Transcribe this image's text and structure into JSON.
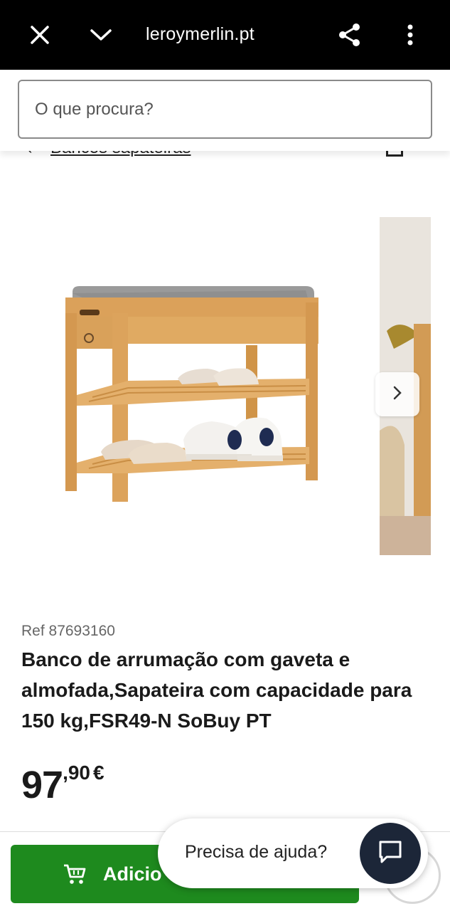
{
  "browser": {
    "url": "leroymerlin.pt",
    "close_icon": "close-icon",
    "collapse_icon": "chevron-down-icon",
    "share_icon": "share-icon",
    "menu_icon": "more-vertical-icon"
  },
  "search": {
    "placeholder": "O que procura?"
  },
  "breadcrumb": {
    "label": "Bancos sapateiras"
  },
  "gallery": {
    "next_icon": "chevron-right-icon"
  },
  "product": {
    "ref": "Ref 87693160",
    "title": "Banco de arrumação com gaveta e almofada,Sapateira com capacidade para 150 kg,FSR49-N SoBuy PT",
    "price_int": "97",
    "price_dec": ",90",
    "price_currency": "€"
  },
  "actions": {
    "add_label": "Adicio",
    "help_label": "Precisa de ajuda?",
    "chat_icon": "chat-icon"
  },
  "colors": {
    "add_button": "#1e8a1e",
    "chat_button": "#1c2638"
  }
}
